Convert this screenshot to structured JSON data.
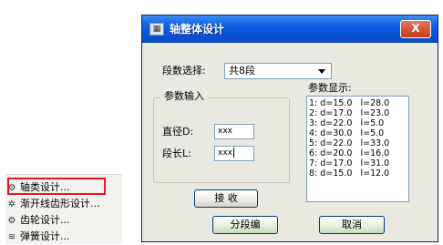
{
  "menu": {
    "items": [
      {
        "icon": "gear-icon",
        "glyph": "⚙",
        "label": "轴类设计..."
      },
      {
        "icon": "involute-gear-icon",
        "glyph": "✲",
        "label": "渐开线齿形设计..."
      },
      {
        "icon": "gear-icon",
        "glyph": "⚙",
        "label": "齿轮设计..."
      },
      {
        "icon": "spring-icon",
        "glyph": "≋",
        "label": "弹簧设计..."
      }
    ]
  },
  "dialog": {
    "title": "轴整体设计",
    "close_label": "X",
    "segment_select_label": "段数选择:",
    "segment_select_value": "共8段",
    "param_input_caption": "参数输入",
    "diameter_label": "直径D:",
    "diameter_value": "xxx",
    "length_label": "段长L:",
    "length_value": "xxx",
    "param_display_label": "参数显示:",
    "param_rows": [
      "1: d=15.0   l=28.0",
      "2: d=17.0   l=23.0",
      "3: d=22.0   l=5.0",
      "4: d=30.0   l=5.0",
      "5: d=22.0   l=33.0",
      "6: d=20.0   l=16.0",
      "7: d=17.0   l=31.0",
      "8: d=15.0   l=12.0"
    ],
    "receive_button": "接 收",
    "segment_edit_button": "分段编",
    "cancel_button": "取消"
  }
}
